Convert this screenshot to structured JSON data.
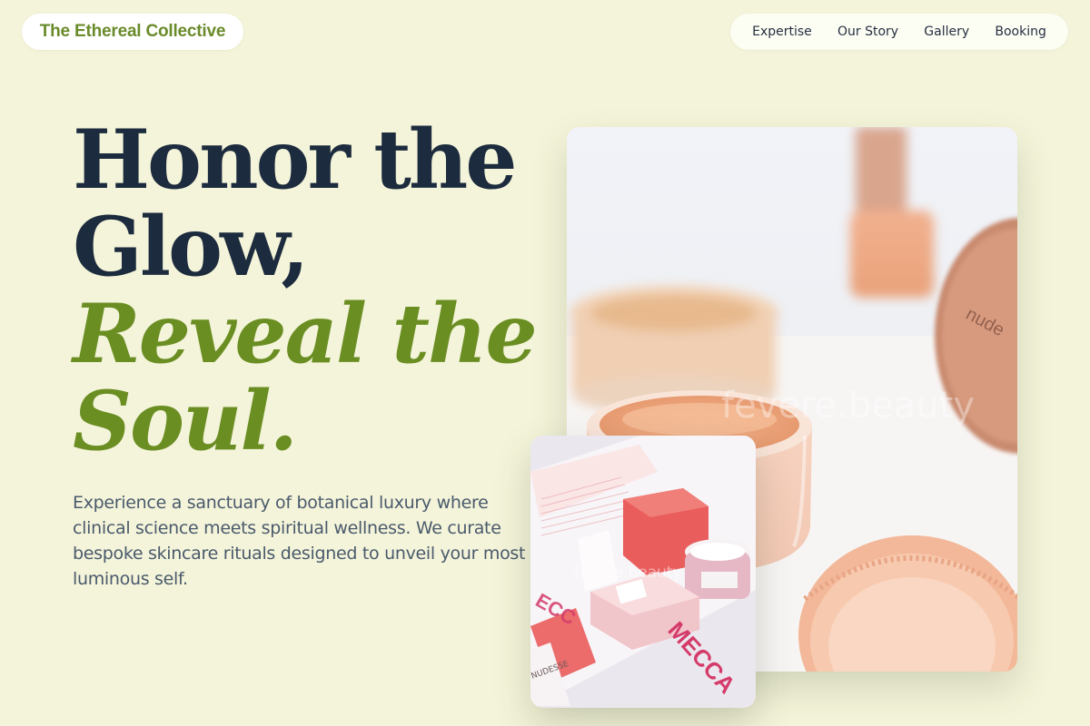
{
  "brand": {
    "name": "The Ethereal Collective"
  },
  "nav": {
    "items": [
      {
        "label": "Expertise"
      },
      {
        "label": "Our Story"
      },
      {
        "label": "Gallery"
      },
      {
        "label": "Booking"
      }
    ]
  },
  "hero": {
    "headline_line1": "Honor the",
    "headline_line2": "Glow,",
    "headline_accent_line1": "Reveal the",
    "headline_accent_line2": "Soul.",
    "description": "Experience a sanctuary of botanical luxury where clinical science meets spiritual wellness. We curate bespoke skincare rituals designed to unveil your most luminous self."
  },
  "images": {
    "main_watermark": "fevere.beauty",
    "main_jar_label": "nude",
    "small_watermark": "fevere.beauty",
    "small_box_label": "MECCA",
    "small_tube_label": "NUDESSE"
  },
  "colors": {
    "background": "#f4f4da",
    "brand_green": "#6b8e23",
    "heading_dark": "#1c2b3d",
    "body_text": "#4a5a6c"
  }
}
